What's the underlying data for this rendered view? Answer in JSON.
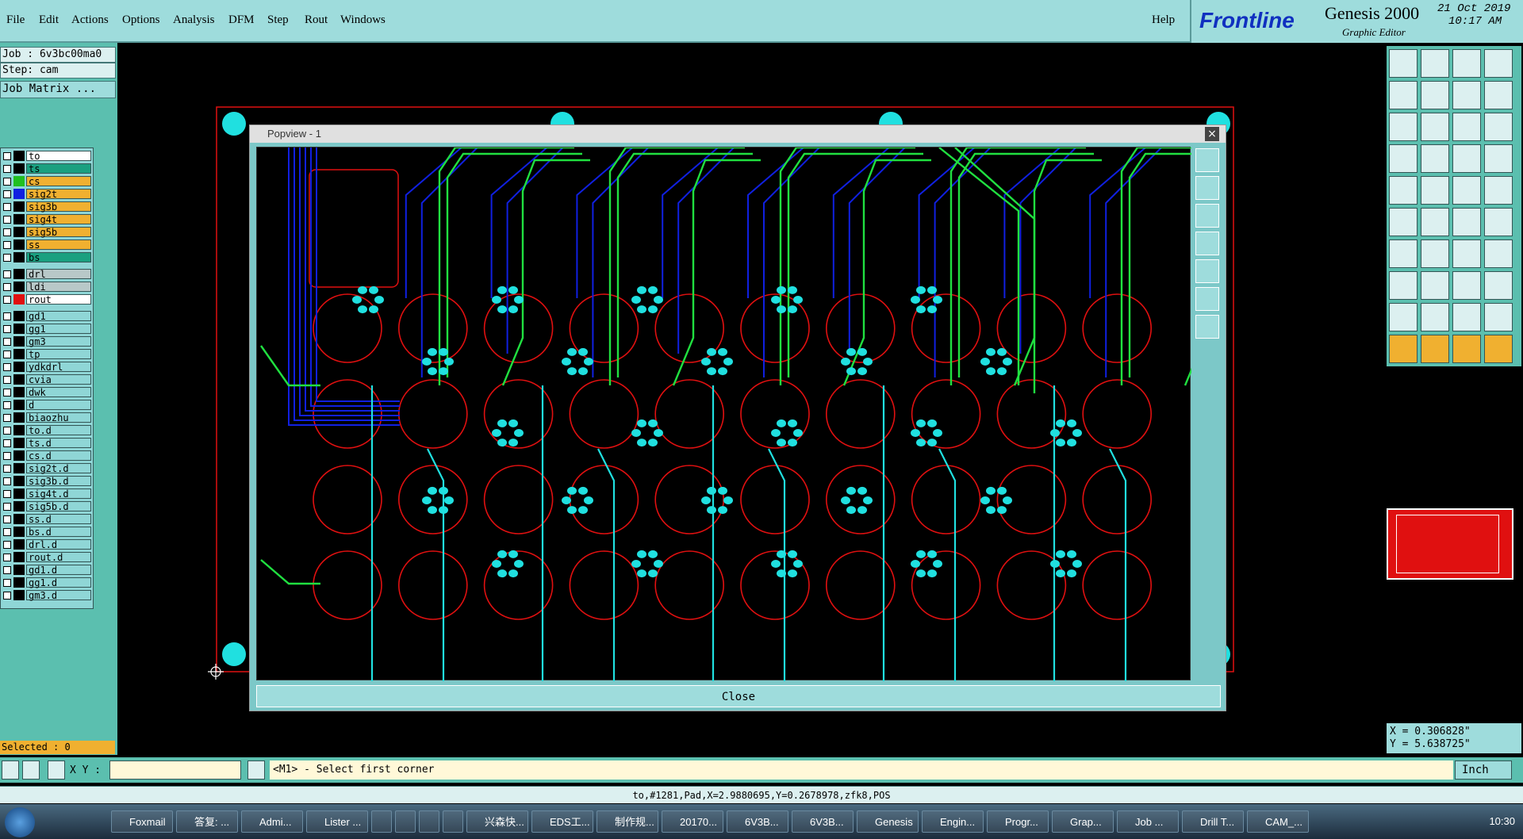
{
  "menu": {
    "items": [
      "File",
      "Edit",
      "Actions",
      "Options",
      "Analysis",
      "DFM",
      "Step",
      "Rout",
      "Windows"
    ],
    "help": "Help"
  },
  "brand": {
    "logo": "Frontline",
    "product": "Genesis 2000",
    "subtitle": "Graphic Editor",
    "date": "21 Oct 2019",
    "time": "10:17 AM"
  },
  "job": {
    "job_line": "Job : 6v3bc00ma0",
    "step_line": "Step: cam",
    "matrix_button": "Job Matrix ..."
  },
  "layers": [
    {
      "name": "to",
      "bg": "#ffffff",
      "swatch": "#000000"
    },
    {
      "name": "ts",
      "bg": "#1aa080",
      "swatch": "#000000"
    },
    {
      "name": "cs",
      "bg": "#f0b030",
      "swatch": "#20c020"
    },
    {
      "name": "sig2t",
      "bg": "#f0b030",
      "swatch": "#1020e0"
    },
    {
      "name": "sig3b",
      "bg": "#f0b030",
      "swatch": "#000000"
    },
    {
      "name": "sig4t",
      "bg": "#f0b030",
      "swatch": "#000000"
    },
    {
      "name": "sig5b",
      "bg": "#f0b030",
      "swatch": "#000000"
    },
    {
      "name": "ss",
      "bg": "#f0b030",
      "swatch": "#000000"
    },
    {
      "name": "bs",
      "bg": "#1aa080",
      "swatch": "#000000"
    },
    {
      "name": "drl",
      "bg": "#b8c8c8",
      "swatch": "#000000"
    },
    {
      "name": "ldi",
      "bg": "#b8c8c8",
      "swatch": "#000000"
    },
    {
      "name": "rout",
      "bg": "#ffffff",
      "swatch": "#e01010"
    },
    {
      "name": "gd1",
      "bg": "#8fd6d6",
      "swatch": "#000000"
    },
    {
      "name": "gg1",
      "bg": "#8fd6d6",
      "swatch": "#000000"
    },
    {
      "name": "gm3",
      "bg": "#8fd6d6",
      "swatch": "#000000"
    },
    {
      "name": "tp",
      "bg": "#8fd6d6",
      "swatch": "#000000"
    },
    {
      "name": "ydkdrl",
      "bg": "#8fd6d6",
      "swatch": "#000000"
    },
    {
      "name": "cvia",
      "bg": "#8fd6d6",
      "swatch": "#000000"
    },
    {
      "name": "dwk",
      "bg": "#8fd6d6",
      "swatch": "#000000"
    },
    {
      "name": "d",
      "bg": "#8fd6d6",
      "swatch": "#000000"
    },
    {
      "name": "biaozhu",
      "bg": "#8fd6d6",
      "swatch": "#000000"
    },
    {
      "name": "to.d",
      "bg": "#8fd6d6",
      "swatch": "#000000"
    },
    {
      "name": "ts.d",
      "bg": "#8fd6d6",
      "swatch": "#000000"
    },
    {
      "name": "cs.d",
      "bg": "#8fd6d6",
      "swatch": "#000000"
    },
    {
      "name": "sig2t.d",
      "bg": "#8fd6d6",
      "swatch": "#000000"
    },
    {
      "name": "sig3b.d",
      "bg": "#8fd6d6",
      "swatch": "#000000"
    },
    {
      "name": "sig4t.d",
      "bg": "#8fd6d6",
      "swatch": "#000000"
    },
    {
      "name": "sig5b.d",
      "bg": "#8fd6d6",
      "swatch": "#000000"
    },
    {
      "name": "ss.d",
      "bg": "#8fd6d6",
      "swatch": "#000000"
    },
    {
      "name": "bs.d",
      "bg": "#8fd6d6",
      "swatch": "#000000"
    },
    {
      "name": "drl.d",
      "bg": "#8fd6d6",
      "swatch": "#000000"
    },
    {
      "name": "rout.d",
      "bg": "#8fd6d6",
      "swatch": "#000000"
    },
    {
      "name": "gd1.d",
      "bg": "#8fd6d6",
      "swatch": "#000000"
    },
    {
      "name": "gg1.d",
      "bg": "#8fd6d6",
      "swatch": "#000000"
    },
    {
      "name": "gm3.d",
      "bg": "#8fd6d6",
      "swatch": "#000000"
    }
  ],
  "selected": "Selected : 0",
  "popview": {
    "title": "Popview - 1",
    "close_label": "Close",
    "close_x": "×"
  },
  "coords": {
    "x": "X = 0.306828\"",
    "y": "Y = 5.638725\""
  },
  "command": {
    "xy_label": "X Y :",
    "xy_value": "",
    "prompt": "<M1> - Select first corner",
    "unit": "Inch"
  },
  "status": "to,#1281,Pad,X=2.9880695,Y=0.2678978,zfk8,POS",
  "taskbar": {
    "items": [
      "Foxmail",
      "答复: ...",
      "Admi...",
      "Lister ...",
      "",
      "",
      "",
      "",
      "兴森快...",
      "EDS工...",
      "制作规...",
      "20170...",
      "6V3B...",
      "6V3B...",
      "Genesis",
      "Engin...",
      "Progr...",
      "Grap...",
      "Job ...",
      "Drill T...",
      "CAM_..."
    ],
    "clock": "10:30"
  },
  "colors": {
    "accent": "#9edcdc",
    "panel": "#5bbfaf",
    "outline": "#e01010",
    "trace_green": "#20e040",
    "trace_blue": "#1020e0",
    "pad_cyan": "#20e0e0"
  }
}
